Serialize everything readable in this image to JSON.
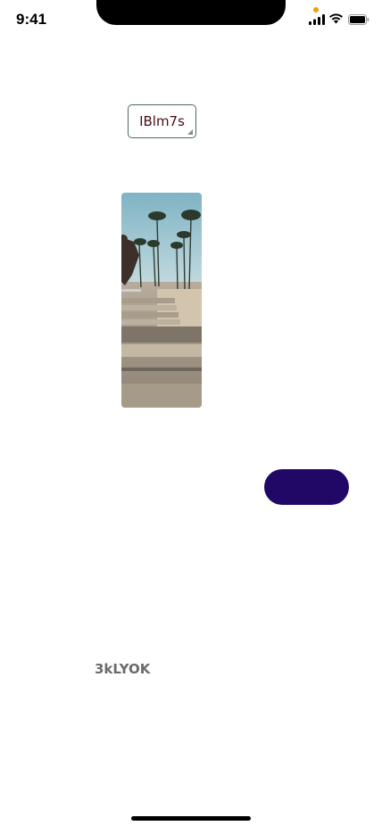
{
  "status_bar": {
    "time": "9:41",
    "icons": [
      "signal-icon",
      "wifi-icon",
      "battery-icon"
    ],
    "privacy_indicator_color": "#f59e0b"
  },
  "dropdown": {
    "selected_value": "IBlm7s",
    "text_color": "#4a0d14",
    "border_color": "#4a6b63"
  },
  "image": {
    "description_icon": "photo-skateboarder"
  },
  "pill_button": {
    "label": "",
    "background": "#220866"
  },
  "bottom_label": {
    "text": "3kLYOK"
  }
}
